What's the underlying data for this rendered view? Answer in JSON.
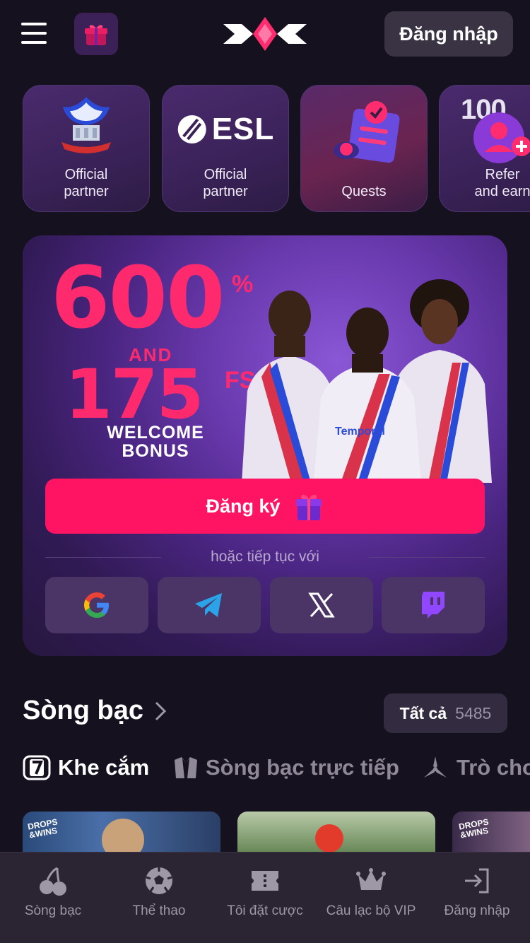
{
  "header": {
    "login_label": "Đăng nhập"
  },
  "partner_cards": [
    {
      "label": "Official\npartner",
      "icon": "crystal-palace-crest"
    },
    {
      "label": "Official\npartner",
      "icon": "esl-logo",
      "logo_text": "ESL"
    },
    {
      "label": "Quests",
      "icon": "quests-icon"
    },
    {
      "label": "Refer\nand earn",
      "icon": "refer-icon",
      "badge": "100"
    }
  ],
  "promo": {
    "amount": "600",
    "percent": "%",
    "and": "AND",
    "spins": "175",
    "fs": "FS",
    "welcome": "WELCOME\nBONUS",
    "jersey_sponsor": "Temporal",
    "signup_label": "Đăng ký",
    "or_continue": "hoặc tiếp tục với",
    "socials": [
      "google",
      "telegram",
      "x",
      "twitch"
    ],
    "accent": "#ff1463"
  },
  "casino": {
    "title": "Sòng bạc",
    "all_label": "Tất cả",
    "all_count": "5485",
    "tabs": [
      {
        "label": "Khe cắm",
        "icon": "seven-icon",
        "active": true
      },
      {
        "label": "Sòng bạc trực tiếp",
        "icon": "tuxedo-icon",
        "active": false
      },
      {
        "label": "Trò chơ",
        "icon": "spinner-icon",
        "active": false
      }
    ],
    "games": [
      {
        "badge": "DROPS\n&WINS"
      },
      {
        "badge": ""
      },
      {
        "badge": "DROPS\n&WINS"
      }
    ]
  },
  "bottom_nav": [
    {
      "label": "Sòng bạc",
      "icon": "cherries-icon"
    },
    {
      "label": "Thể thao",
      "icon": "soccer-ball-icon"
    },
    {
      "label": "Tôi đặt cược",
      "icon": "ticket-icon"
    },
    {
      "label": "Câu lạc bộ VIP",
      "icon": "crown-icon"
    },
    {
      "label": "Đăng nhập",
      "icon": "login-arrow-icon"
    }
  ]
}
